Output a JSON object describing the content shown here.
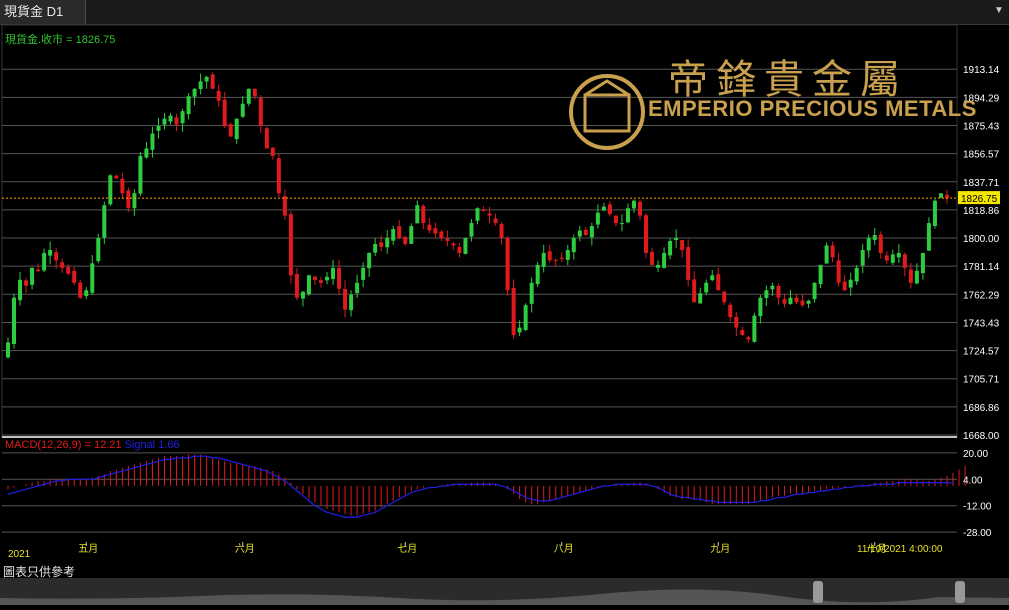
{
  "window": {
    "tab_title": "現貨金 D1"
  },
  "brand": {
    "name_zh": "帝鋒貴金屬",
    "name_en": "EMPERIO PRECIOUS METALS",
    "gold": "#c9a04e"
  },
  "price_label": "現貨金.收市 = 1826.75",
  "current_price": "1826.75",
  "macd": {
    "label": "MACD(12,26,9) = 12.21",
    "signal_label": "Signal",
    "signal_value": "1.66"
  },
  "year_label": "2021",
  "last_bar_time": "11/10/2021 4:00:00",
  "caption": "圖表只供參考",
  "colors": {
    "up": "#2ecc40",
    "down": "#e01b1b",
    "grid": "#555555",
    "axis_text": "#ffffff",
    "price_line": "#ffa500",
    "macd_hist": "#e01b1b",
    "signal": "#1f1fe6",
    "background": "#000000"
  },
  "chart_data": [
    {
      "type": "candlestick",
      "title": "現貨金 D1",
      "y_ticks": [
        "1913.14",
        "1894.29",
        "1875.43",
        "1856.57",
        "1837.71",
        "1818.86",
        "1800.00",
        "1781.14",
        "1762.29",
        "1743.43",
        "1724.57",
        "1705.71",
        "1686.86",
        "1668.00"
      ],
      "x_labels": [
        "五月",
        "六月",
        "七月",
        "八月",
        "九月",
        "十月"
      ],
      "ylim": [
        1668.0,
        1926
      ],
      "close_last": 1826.75,
      "closes": [
        1730,
        1760,
        1772,
        1768,
        1780,
        1778,
        1790,
        1792,
        1785,
        1780,
        1776,
        1770,
        1760,
        1765,
        1783,
        1800,
        1822,
        1842,
        1840,
        1830,
        1820,
        1830,
        1855,
        1860,
        1870,
        1875,
        1880,
        1882,
        1876,
        1885,
        1895,
        1900,
        1905,
        1908,
        1900,
        1892,
        1875,
        1868,
        1880,
        1890,
        1900,
        1895,
        1875,
        1860,
        1855,
        1830,
        1815,
        1775,
        1760,
        1764,
        1775,
        1772,
        1770,
        1774,
        1780,
        1766,
        1752,
        1762,
        1770,
        1780,
        1790,
        1796,
        1794,
        1800,
        1806,
        1800,
        1796,
        1808,
        1822,
        1810,
        1805,
        1803,
        1800,
        1798,
        1795,
        1790,
        1800,
        1810,
        1820,
        1818,
        1815,
        1810,
        1800,
        1765,
        1735,
        1740,
        1755,
        1770,
        1782,
        1790,
        1785,
        1785,
        1786,
        1792,
        1800,
        1805,
        1802,
        1808,
        1817,
        1821,
        1816,
        1810,
        1810,
        1820,
        1825,
        1815,
        1790,
        1782,
        1782,
        1790,
        1798,
        1800,
        1792,
        1772,
        1757,
        1763,
        1770,
        1775,
        1765,
        1757,
        1747,
        1740,
        1735,
        1732,
        1748,
        1760,
        1765,
        1768,
        1760,
        1756,
        1760,
        1757,
        1755,
        1758,
        1770,
        1782,
        1795,
        1787,
        1770,
        1765,
        1772,
        1780,
        1792,
        1800,
        1802,
        1790,
        1785,
        1789,
        1790,
        1780,
        1770,
        1778,
        1790,
        1810,
        1825,
        1830,
        1826.75
      ],
      "macd_hist": [
        -2,
        -1,
        0,
        1,
        2,
        3,
        3,
        4,
        4,
        4,
        4,
        4,
        4,
        4,
        5,
        6,
        7,
        9,
        10,
        11,
        12,
        13,
        14,
        15,
        16,
        17,
        18,
        18,
        18,
        18,
        19,
        19,
        19,
        18,
        17,
        16,
        15,
        14,
        14,
        13,
        12,
        12,
        11,
        10,
        9,
        7,
        5,
        2,
        -2,
        -5,
        -8,
        -10,
        -12,
        -14,
        -15,
        -16,
        -17,
        -18,
        -18,
        -17,
        -16,
        -15,
        -13,
        -11,
        -9,
        -7,
        -5,
        -3,
        -2,
        -1,
        0,
        0,
        0,
        1,
        1,
        1,
        1,
        2,
        2,
        2,
        2,
        1,
        0,
        -2,
        -5,
        -8,
        -10,
        -11,
        -11,
        -10,
        -9,
        -8,
        -7,
        -6,
        -5,
        -4,
        -3,
        -2,
        -1,
        0,
        0,
        1,
        1,
        1,
        2,
        2,
        1,
        0,
        -2,
        -4,
        -6,
        -7,
        -8,
        -8,
        -8,
        -9,
        -10,
        -11,
        -11,
        -11,
        -11,
        -11,
        -11,
        -11,
        -10,
        -9,
        -8,
        -7,
        -6,
        -6,
        -5,
        -5,
        -5,
        -4,
        -3,
        -3,
        -2,
        -2,
        -1,
        -1,
        0,
        0,
        1,
        1,
        2,
        2,
        3,
        3,
        3,
        4,
        4,
        4,
        3,
        3,
        4,
        5,
        6,
        8,
        10,
        12.21
      ],
      "signal": [
        -5,
        -4,
        -3,
        -2,
        -1,
        0,
        1,
        2,
        3,
        3,
        4,
        4,
        4,
        4,
        4,
        5,
        6,
        7,
        8,
        9,
        10,
        11,
        12,
        13,
        14,
        15,
        16,
        16,
        17,
        17,
        17,
        18,
        18,
        18,
        17,
        17,
        16,
        15,
        14,
        13,
        12,
        11,
        10,
        9,
        7,
        5,
        3,
        0,
        -3,
        -6,
        -9,
        -12,
        -14,
        -16,
        -17,
        -18,
        -19,
        -19,
        -19,
        -18,
        -17,
        -16,
        -14,
        -12,
        -10,
        -8,
        -6,
        -4,
        -3,
        -2,
        -1,
        -1,
        0,
        0,
        1,
        1,
        1,
        1,
        1,
        1,
        1,
        1,
        0,
        -1,
        -3,
        -5,
        -7,
        -8,
        -9,
        -9,
        -9,
        -8,
        -7,
        -6,
        -5,
        -4,
        -3,
        -2,
        -1,
        0,
        0,
        1,
        1,
        1,
        1,
        1,
        1,
        0,
        -1,
        -3,
        -5,
        -6,
        -7,
        -7,
        -8,
        -8,
        -9,
        -9,
        -10,
        -10,
        -10,
        -10,
        -10,
        -10,
        -10,
        -9,
        -9,
        -8,
        -7,
        -7,
        -6,
        -5,
        -5,
        -4,
        -4,
        -3,
        -3,
        -2,
        -2,
        -1,
        -1,
        0,
        0,
        0,
        1,
        1,
        1,
        1,
        2,
        2,
        2,
        2,
        2,
        2,
        2,
        2,
        2,
        1.66
      ],
      "macd_ylim": [
        -34,
        26
      ],
      "macd_ticks": [
        "20.00",
        "4.00",
        "-12.00",
        "-28.00"
      ]
    }
  ]
}
